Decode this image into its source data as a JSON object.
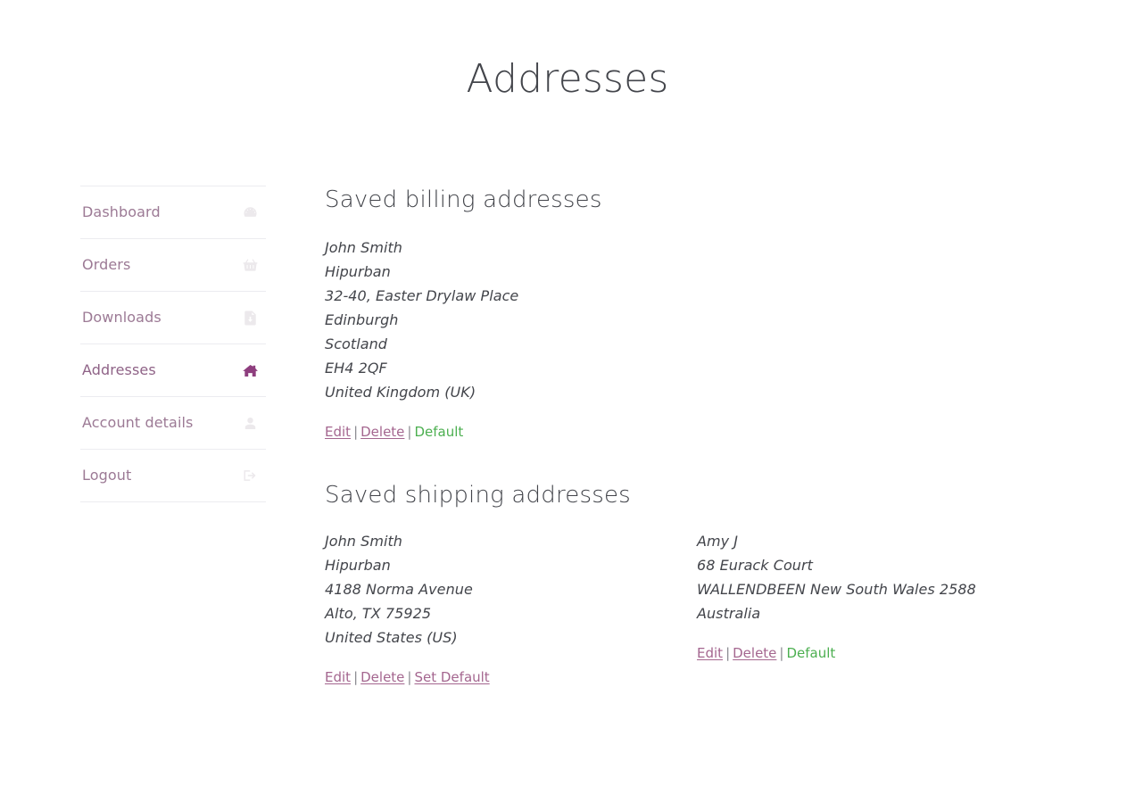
{
  "page": {
    "title": "Addresses"
  },
  "sidebar": {
    "items": [
      {
        "label": "Dashboard",
        "icon": "dashboard-gauge-icon",
        "active": false
      },
      {
        "label": "Orders",
        "icon": "shopping-basket-icon",
        "active": false
      },
      {
        "label": "Downloads",
        "icon": "download-file-icon",
        "active": false
      },
      {
        "label": "Addresses",
        "icon": "home-icon",
        "active": true
      },
      {
        "label": "Account details",
        "icon": "user-icon",
        "active": false
      },
      {
        "label": "Logout",
        "icon": "sign-out-icon",
        "active": false
      }
    ]
  },
  "main": {
    "billing": {
      "heading": "Saved billing addresses",
      "address": {
        "lines": [
          "John Smith",
          "Hipurban",
          "32-40, Easter Drylaw Place",
          "Edinburgh",
          "Scotland",
          "EH4 2QF",
          "United Kingdom (UK)"
        ],
        "actions": {
          "edit": "Edit",
          "delete": "Delete",
          "default": "Default",
          "separator": "|"
        }
      }
    },
    "shipping": {
      "heading": "Saved shipping addresses",
      "addresses": [
        {
          "lines": [
            "John Smith",
            "Hipurban",
            "4188 Norma Avenue",
            "Alto, TX 75925",
            "United States (US)"
          ],
          "actions": {
            "edit": "Edit",
            "delete": "Delete",
            "default": "Set Default",
            "separator": "|"
          }
        },
        {
          "lines": [
            "Amy J",
            "68 Eurack Court",
            "WALLENDBEEN New South Wales 2588",
            "Australia"
          ],
          "actions": {
            "edit": "Edit",
            "delete": "Delete",
            "default": "Default",
            "separator": "|"
          }
        }
      ]
    }
  },
  "colors": {
    "link": "#a4668f",
    "nav_link": "#9c7a95",
    "nav_active": "#8f6387",
    "icon_active": "#8e3e7e",
    "icon_muted": "#ece9ec",
    "heading": "#43454b",
    "default_flag": "#4caf50",
    "divider": "#ececf0"
  }
}
